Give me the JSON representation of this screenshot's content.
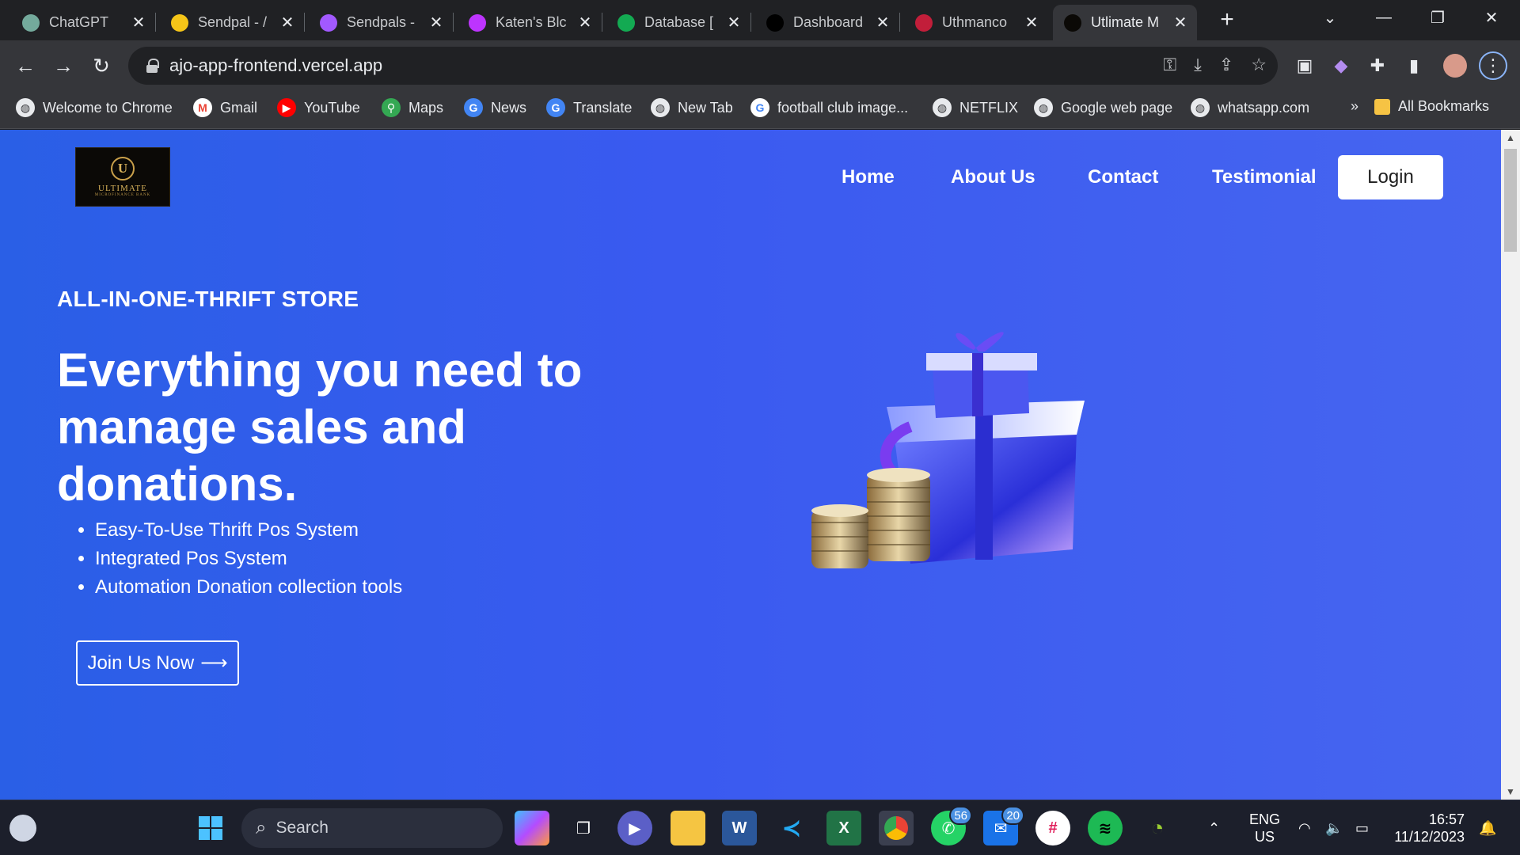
{
  "browser": {
    "tabs": [
      {
        "title": "ChatGPT",
        "icon": "chatgpt-icon",
        "color": "#74aa9c",
        "active": false
      },
      {
        "title": "Sendpal - /",
        "icon": "sendpal-icon",
        "color": "#f5c518",
        "active": false
      },
      {
        "title": "Sendpals -",
        "icon": "figma-icon",
        "color": "#a259ff",
        "active": false
      },
      {
        "title": "Katen's Blc",
        "icon": "vite-icon",
        "color": "#bd34fe",
        "active": false
      },
      {
        "title": "Database [",
        "icon": "mongodb-icon",
        "color": "#13aa52",
        "active": false
      },
      {
        "title": "Dashboard",
        "icon": "vercel-icon",
        "color": "#000000",
        "active": false
      },
      {
        "title": "Uthmanco",
        "icon": "uthmanco-icon",
        "color": "#c21e3a",
        "active": false
      },
      {
        "title": "Utlimate M",
        "icon": "ultimate-icon",
        "color": "#0b0906",
        "active": true
      }
    ],
    "url": "ajo-app-frontend.vercel.app",
    "bookmarks": [
      {
        "label": "Welcome to Chrome",
        "icon": "globe-icon"
      },
      {
        "label": "Gmail",
        "icon": "gmail-icon"
      },
      {
        "label": "YouTube",
        "icon": "youtube-icon"
      },
      {
        "label": "Maps",
        "icon": "maps-icon"
      },
      {
        "label": "News",
        "icon": "news-icon"
      },
      {
        "label": "Translate",
        "icon": "translate-icon"
      },
      {
        "label": "New Tab",
        "icon": "globe-icon"
      },
      {
        "label": "football club image...",
        "icon": "google-icon"
      },
      {
        "label": "NETFLIX",
        "icon": "globe-icon"
      },
      {
        "label": "Google web page",
        "icon": "globe-icon"
      },
      {
        "label": "whatsapp.com",
        "icon": "globe-icon"
      }
    ],
    "more_bookmarks": "»",
    "all_bookmarks": "All Bookmarks"
  },
  "site": {
    "logo": {
      "letter": "U",
      "name": "ULTIMATE",
      "sub": "MICROFINANCE BANK"
    },
    "nav": [
      "Home",
      "About Us",
      "Contact",
      "Testimonial"
    ],
    "login": "Login",
    "eyebrow": "ALL-IN-ONE-THRIFT STORE",
    "headline": "Everything you need to manage sales and donations.",
    "features": [
      "Easy-To-Use Thrift Pos System",
      "Integrated Pos System",
      "Automation Donation collection tools"
    ],
    "cta": "Join Us Now",
    "cta_arrow": "⟶",
    "accent": "#3a5af0"
  },
  "taskbar": {
    "search_placeholder": "Search",
    "badges": {
      "whatsapp": "56",
      "mail": "20"
    },
    "lang_line1": "ENG",
    "lang_line2": "US",
    "time": "16:57",
    "date": "11/12/2023"
  }
}
